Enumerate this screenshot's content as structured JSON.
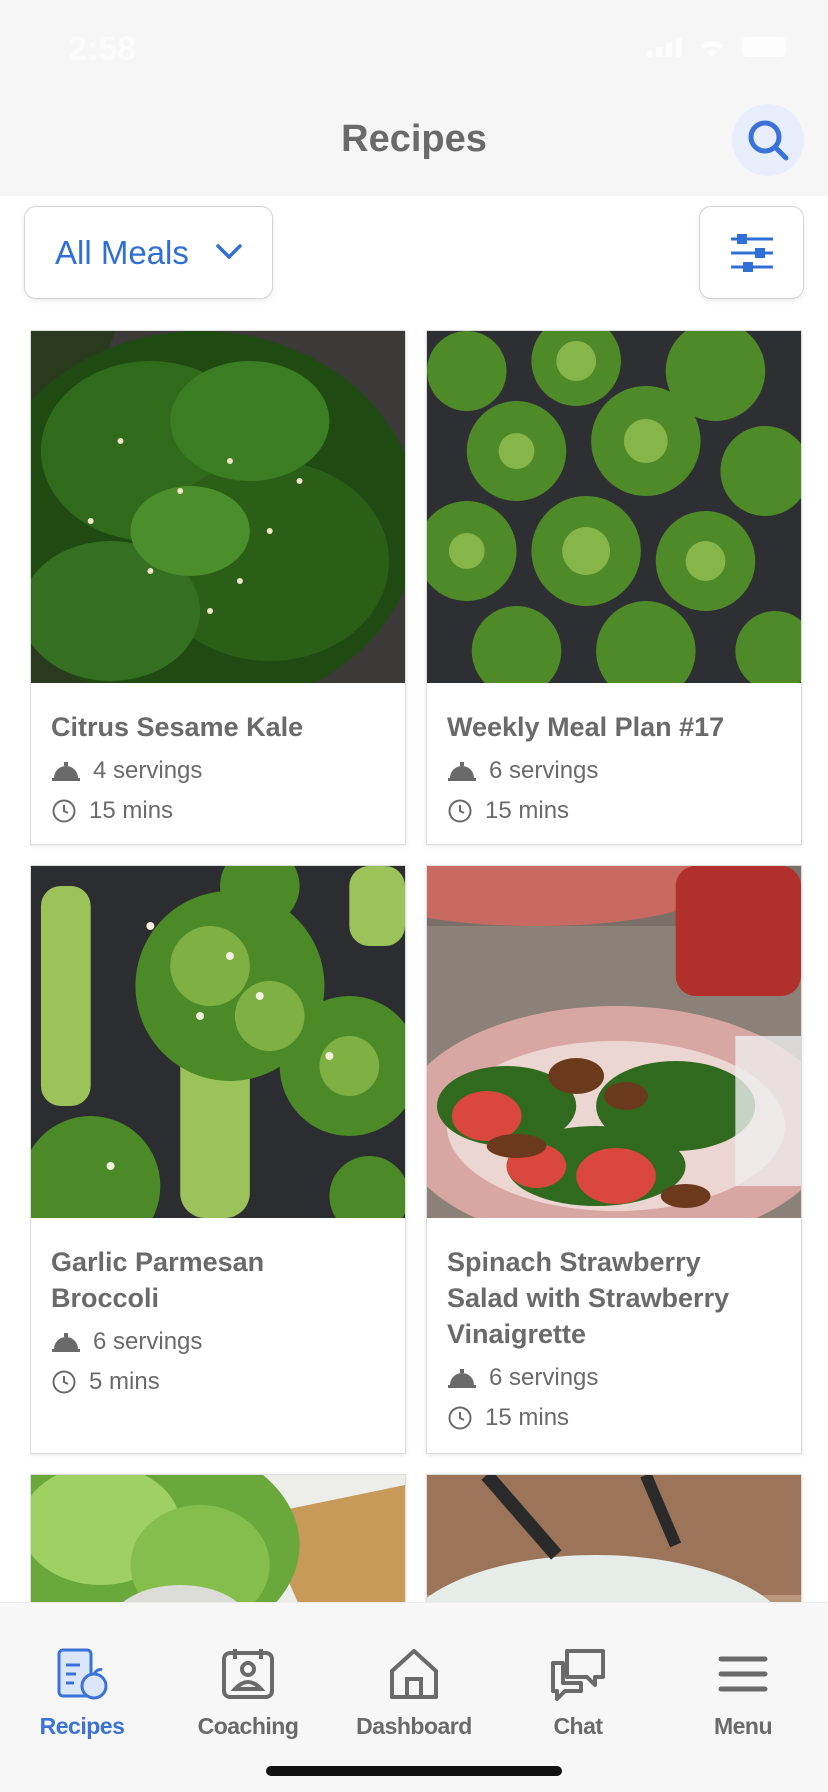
{
  "status": {
    "time": "2:58"
  },
  "header": {
    "title": "Recipes"
  },
  "filter": {
    "meal_type": "All Meals"
  },
  "recipes": [
    {
      "title": "Citrus Sesame Kale",
      "servings": "4 servings",
      "time": "15 mins",
      "image": "kale"
    },
    {
      "title": "Weekly Meal Plan #17",
      "servings": "6 servings",
      "time": "15 mins",
      "image": "broccoli"
    },
    {
      "title": "Garlic Parmesan Broccoli",
      "servings": "6 servings",
      "time": "5 mins",
      "image": "broccoli-closeup"
    },
    {
      "title": "Spinach Strawberry Salad with Strawberry Vinaigrette",
      "servings": "6 servings",
      "time": "15 mins",
      "image": "salad"
    },
    {
      "title": "",
      "image": "lettuce"
    },
    {
      "title": "",
      "image": "bowl"
    }
  ],
  "tabs": [
    {
      "label": "Recipes",
      "icon": "recipes-icon",
      "active": true
    },
    {
      "label": "Coaching",
      "icon": "coaching-icon",
      "active": false
    },
    {
      "label": "Dashboard",
      "icon": "home-icon",
      "active": false
    },
    {
      "label": "Chat",
      "icon": "chat-icon",
      "active": false
    },
    {
      "label": "Menu",
      "icon": "menu-icon",
      "active": false
    }
  ],
  "colors": {
    "accent": "#3b72d9",
    "text": "#6a6a6a",
    "header_bg": "#f6f6f6"
  }
}
